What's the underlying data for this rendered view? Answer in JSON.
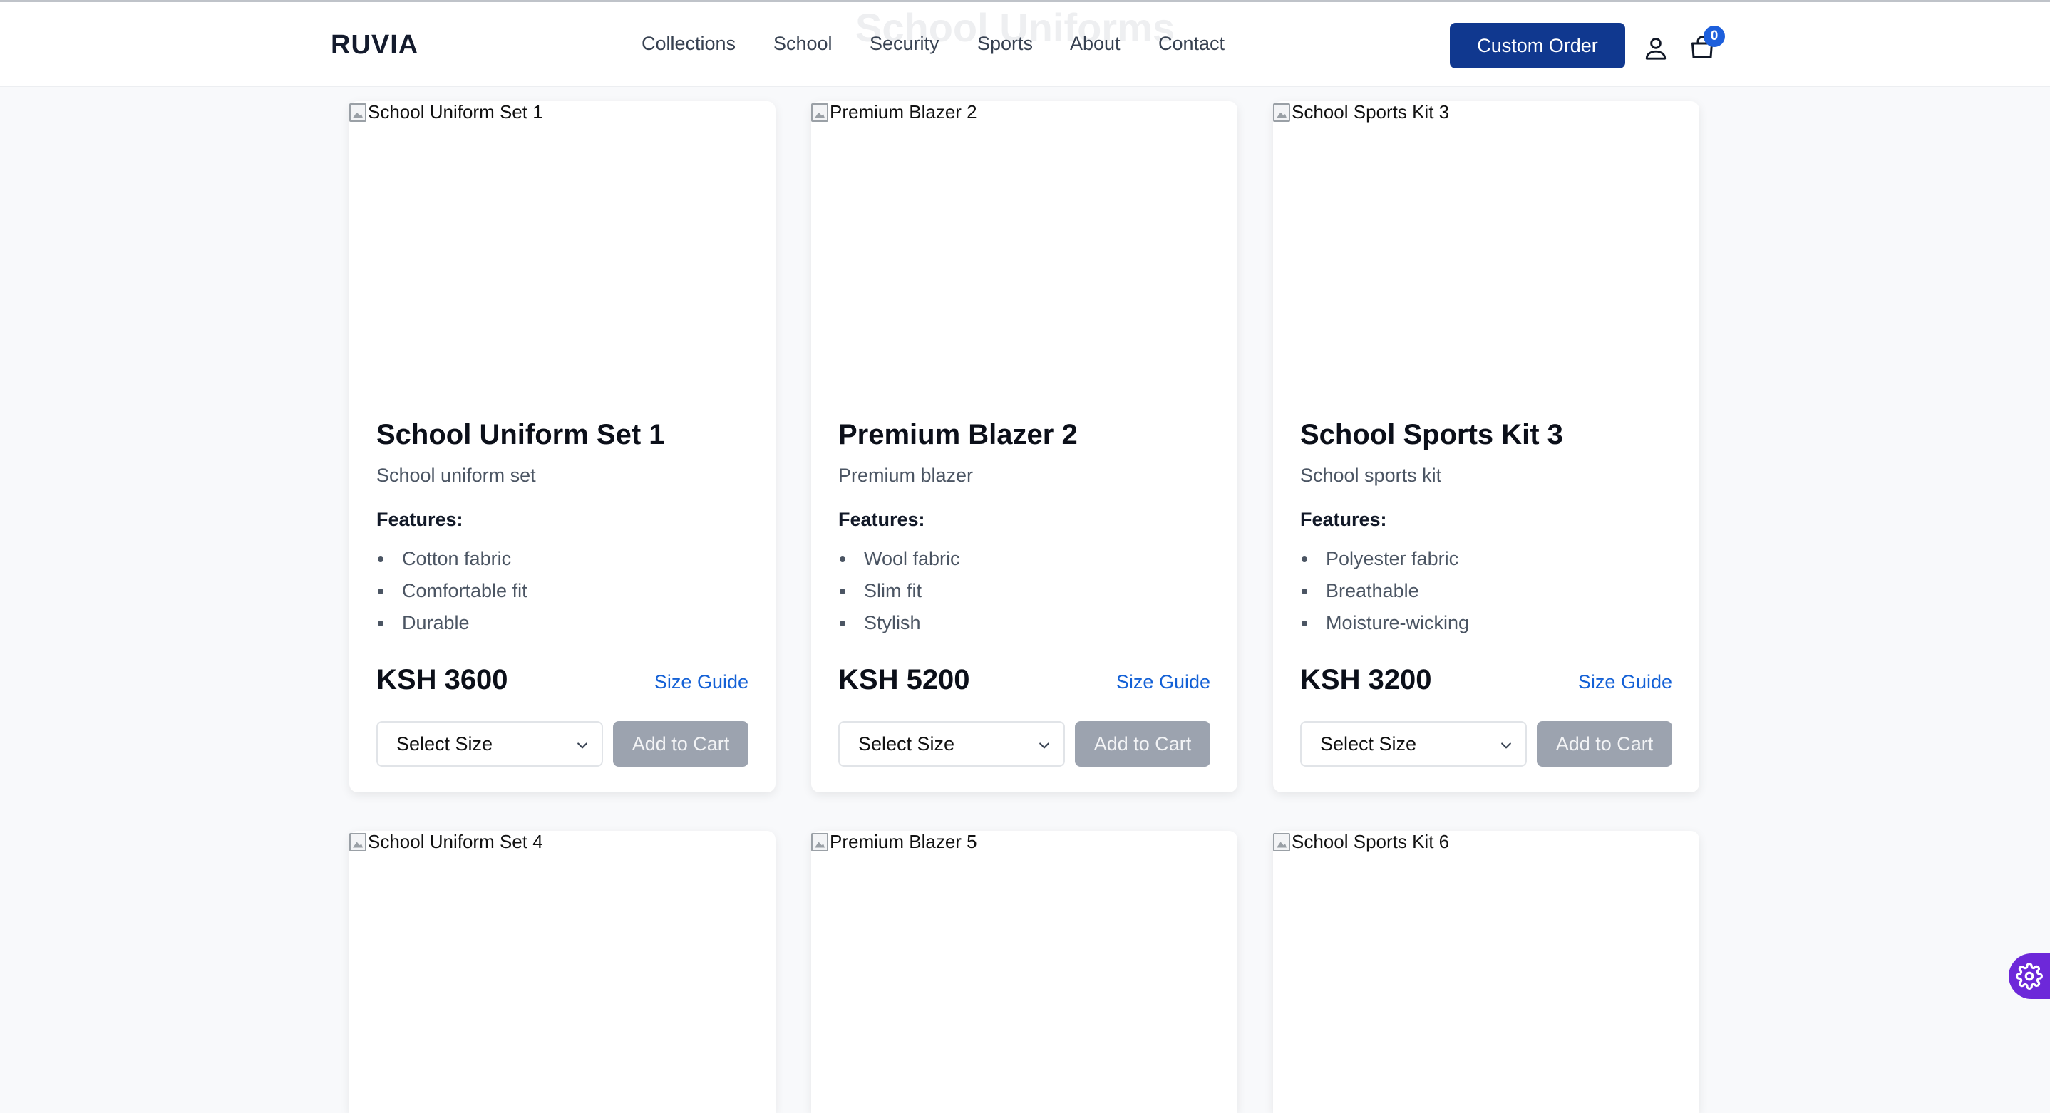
{
  "header": {
    "ghost_title": "School Uniforms",
    "logo": "RUVIA",
    "nav": [
      "Collections",
      "School",
      "Security",
      "Sports",
      "About",
      "Contact"
    ],
    "custom_order": "Custom Order",
    "cart_count": "0",
    "brand_color": "#10388f"
  },
  "products": [
    {
      "image_alt": "School Uniform Set 1",
      "title": "School Uniform Set 1",
      "description": "School uniform set",
      "features_label": "Features:",
      "features": [
        "Cotton fabric",
        "Comfortable fit",
        "Durable"
      ],
      "price": "KSH 3600",
      "size_guide": "Size Guide",
      "size_select": "Select Size",
      "add_to_cart": "Add to Cart"
    },
    {
      "image_alt": "Premium Blazer 2",
      "title": "Premium Blazer 2",
      "description": "Premium blazer",
      "features_label": "Features:",
      "features": [
        "Wool fabric",
        "Slim fit",
        "Stylish"
      ],
      "price": "KSH 5200",
      "size_guide": "Size Guide",
      "size_select": "Select Size",
      "add_to_cart": "Add to Cart"
    },
    {
      "image_alt": "School Sports Kit 3",
      "title": "School Sports Kit 3",
      "description": "School sports kit",
      "features_label": "Features:",
      "features": [
        "Polyester fabric",
        "Breathable",
        "Moisture-wicking"
      ],
      "price": "KSH 3200",
      "size_guide": "Size Guide",
      "size_select": "Select Size",
      "add_to_cart": "Add to Cart"
    },
    {
      "image_alt": "School Uniform Set 4"
    },
    {
      "image_alt": "Premium Blazer 5"
    },
    {
      "image_alt": "School Sports Kit 6"
    }
  ]
}
